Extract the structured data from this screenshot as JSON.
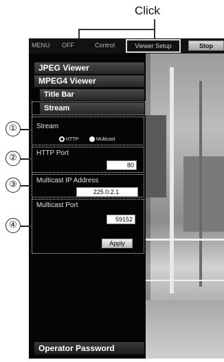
{
  "callout": {
    "label": "Click"
  },
  "topbar": {
    "menu_label": "MENU",
    "off_label": "OFF",
    "control_label": "Control",
    "viewer_setup_label": "Viewer Setup",
    "stop_label": "Stop"
  },
  "sidebar": {
    "items": [
      {
        "label": "JPEG Viewer"
      },
      {
        "label": "MPEG4 Viewer"
      },
      {
        "label": "Title Bar"
      },
      {
        "label": "Stream"
      }
    ],
    "footer_label": "Operator Password"
  },
  "form": {
    "stream": {
      "title": "Stream",
      "options": [
        "HTTP",
        "Multicast"
      ],
      "selected": "HTTP"
    },
    "http_port": {
      "title": "HTTP Port",
      "value": "80"
    },
    "multicast_ip": {
      "title": "Multicast IP Address",
      "value": "225.0.2.1"
    },
    "multicast_port": {
      "title": "Multicast Port",
      "value": "59152"
    },
    "apply_label": "Apply"
  },
  "markers": [
    "①",
    "②",
    "③",
    "④"
  ]
}
